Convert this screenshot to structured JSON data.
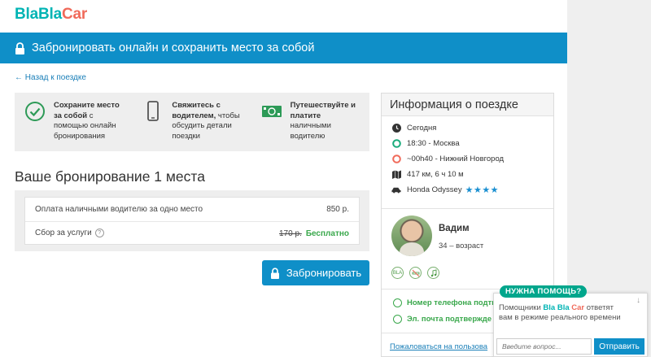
{
  "logo": {
    "part1": "Bla",
    "part2": "Bla",
    "part3": "Car"
  },
  "banner": {
    "text": "Забронировать онлайн и сохранить место за собой"
  },
  "back_link": "← Назад к поездке",
  "benefits": [
    {
      "icon": "check-circle-icon",
      "bold": "Сохраните место за собой",
      "rest": " с помощью онлайн бронирования"
    },
    {
      "icon": "phone-icon",
      "bold": "Свяжитесь с водителем,",
      "rest": " чтобы обсудить детали поездки"
    },
    {
      "icon": "cash-icon",
      "bold": "Путешествуйте и платите",
      "rest": " наличными водителю"
    }
  ],
  "booking": {
    "title": "Ваше бронирование 1 места",
    "rows": [
      {
        "label": "Оплата наличными водителю за одно место",
        "value": "850 р."
      },
      {
        "label": "Сбор за услуги",
        "old_value": "170 р.",
        "value": "Бесплатно"
      }
    ],
    "button": "Забронировать"
  },
  "trip": {
    "title": "Информация о поездке",
    "date": "Сегодня",
    "departure": "18:30 - Москва",
    "arrival": "~00h40 - Нижний Новгород",
    "distance": "417 км, 6 ч 10 м",
    "car": "Honda Odyssey",
    "car_rating": "★★★★",
    "driver_name": "Вадим",
    "driver_age": "34 – возраст",
    "pref_icons": [
      "blabla-icon",
      "no-smoking-icon",
      "music-icon"
    ],
    "verified_phone": "Номер телефона подтв",
    "verified_email": "Эл. почта подтвержде",
    "report_link": "Пожаловаться на пользова"
  },
  "help": {
    "badge": "НУЖНА ПОМОЩЬ?",
    "text_before": "Помощники ",
    "brand_bla": "Bla Bla",
    "brand_car": " Car",
    "text_after": " ответят вам в режиме реального времени",
    "close": "↓",
    "placeholder": "Введите вопрос...",
    "send": "Отправить"
  },
  "colors": {
    "accent": "#0f8fc8",
    "brand_teal": "#00b4b4",
    "brand_coral": "#f06a5a",
    "success": "#3aa84c"
  }
}
